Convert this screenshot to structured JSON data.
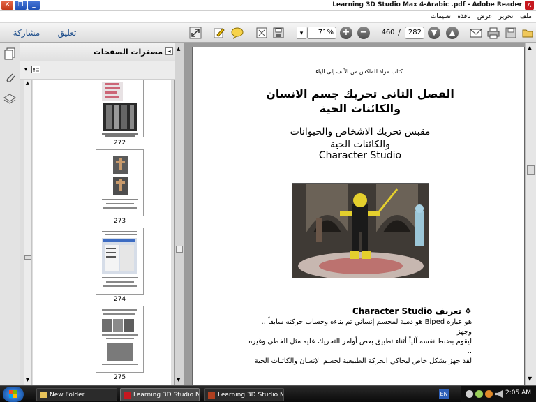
{
  "window": {
    "title": "Learning 3D Studio Max 4-Arabic .pdf - Adobe Reader",
    "app_icon_label": "A"
  },
  "menu": [
    "ملف",
    "تحرير",
    "عرض",
    "نافذة",
    "تعليمات"
  ],
  "toolbar": {
    "share_label": "مشاركة",
    "comment_label": "تعليق",
    "zoom_value": "71%",
    "current_page": "460",
    "separator": "/",
    "total_pages": "282"
  },
  "thumbnails": {
    "title": "مصغرات الصفحات",
    "pages": [
      "272",
      "273",
      "274",
      "275"
    ]
  },
  "page": {
    "running_head": "كتاب مراد للماكس من الألف إلى الياء",
    "chapter_title_line1": "الفصل الثانى تحريك جسم الانسان",
    "chapter_title_line2": "والكائنات الحية",
    "subtitle_line1": "مقبس تحريك الاشخاص والحيوانات",
    "subtitle_line2": "والكائنات الحية",
    "subtitle_line3": "Character Studio",
    "section_heading": "❖ تعريف Character Studio",
    "body_lines": [
      "هو عبارة Biped هو دمية لمجسم إنساني تم بناءه وحساب حركته سابقاً .. وجهز",
      "ليقوم بضبط نفسه آلياً أثناء تطبيق بعض أوامر التحريك عليه مثل الخطى وغيره ..",
      "لقد جهز بشكل خاص ليحاكي الحركة الطبيعية لجسم الإنسان والكائنات الحية"
    ]
  },
  "taskbar": {
    "tasks": [
      "New Folder",
      "Learning 3D Studio Ma...",
      "Learning 3D Studio Ma..."
    ],
    "language": "EN",
    "clock": "2:05 AM"
  },
  "colors": {
    "reader_red": "#c6181f",
    "toolbar_bg": "#e6e6e6",
    "doc_bg": "#9b9b9b"
  }
}
